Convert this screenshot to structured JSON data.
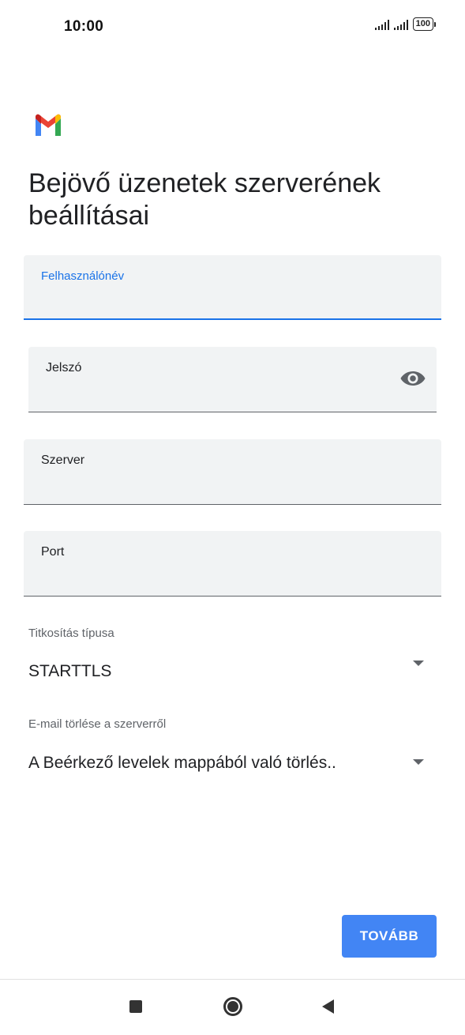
{
  "status_bar": {
    "time": "10:00",
    "battery": "100"
  },
  "app": {
    "logo_icon": "gmail-logo-icon",
    "title": "Bejövő üzenetek szerverének beállításai"
  },
  "form": {
    "username": {
      "label": "Felhasználónév",
      "value": ""
    },
    "password": {
      "label": "Jelszó",
      "value": "",
      "toggle_icon": "eye-icon"
    },
    "server": {
      "label": "Szerver",
      "value": ""
    },
    "port": {
      "label": "Port",
      "value": ""
    },
    "encryption": {
      "label": "Titkosítás típusa",
      "value": "STARTTLS"
    },
    "delete_email": {
      "label": "E-mail törlése a szerverről",
      "value": "A Beérkező levelek mappából való törlés.."
    }
  },
  "actions": {
    "next_label": "TOVÁBB"
  },
  "colors": {
    "accent": "#1a73e8",
    "button": "#4285f4",
    "field_bg": "#f1f3f4"
  }
}
